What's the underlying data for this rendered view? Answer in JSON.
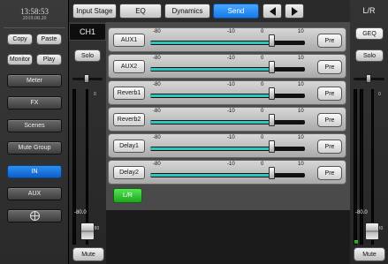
{
  "clock": {
    "time": "13:58:53",
    "date": "2019.08.20"
  },
  "left_panel": {
    "copy_label": "Copy",
    "paste_label": "Paste",
    "monitor_label": "Monitor",
    "play_label": "Play",
    "nav": [
      {
        "label": "Meter"
      },
      {
        "label": "FX"
      },
      {
        "label": "Scenes"
      },
      {
        "label": "Mute Group"
      },
      {
        "label": "IN",
        "active": true
      },
      {
        "label": "AUX"
      },
      {
        "label": "",
        "icon": "target-icon"
      }
    ]
  },
  "channel_strip": {
    "name": "CH1",
    "solo_label": "Solo",
    "mute_label": "Mute",
    "fader_value": "-80.0",
    "scale_top": "0",
    "scale_bottom": "-80"
  },
  "master_strip": {
    "name": "L/R",
    "geq_label": "GEQ",
    "solo_label": "Solo",
    "mute_label": "Mute",
    "fader_value": "-80.0",
    "scale_top": "0",
    "scale_bottom": "-80"
  },
  "tabs": [
    {
      "label": "Input Stage"
    },
    {
      "label": "EQ"
    },
    {
      "label": "Dynamics"
    },
    {
      "label": "Send",
      "active": true
    }
  ],
  "nav_arrows": {
    "prev": "arrow-left-icon",
    "next": "arrow-right-icon"
  },
  "sends": {
    "scale": [
      "-80",
      "-10",
      "0",
      "10"
    ],
    "rows": [
      {
        "name": "AUX1",
        "level": 0.78,
        "pre_label": "Pre"
      },
      {
        "name": "AUX2",
        "level": 0.78,
        "pre_label": "Pre"
      },
      {
        "name": "Reverb1",
        "level": 0.78,
        "pre_label": "Pre"
      },
      {
        "name": "Reverb2",
        "level": 0.78,
        "pre_label": "Pre"
      },
      {
        "name": "Delay1",
        "level": 0.78,
        "pre_label": "Pre"
      },
      {
        "name": "Delay2",
        "level": 0.78,
        "pre_label": "Pre"
      }
    ]
  },
  "lr_label": "L/R",
  "colors": {
    "accent_blue": "#1e88f0",
    "send_fill": "#2ec4bf",
    "lr_green": "#2fc52f",
    "meter_green": "#22bb22"
  }
}
